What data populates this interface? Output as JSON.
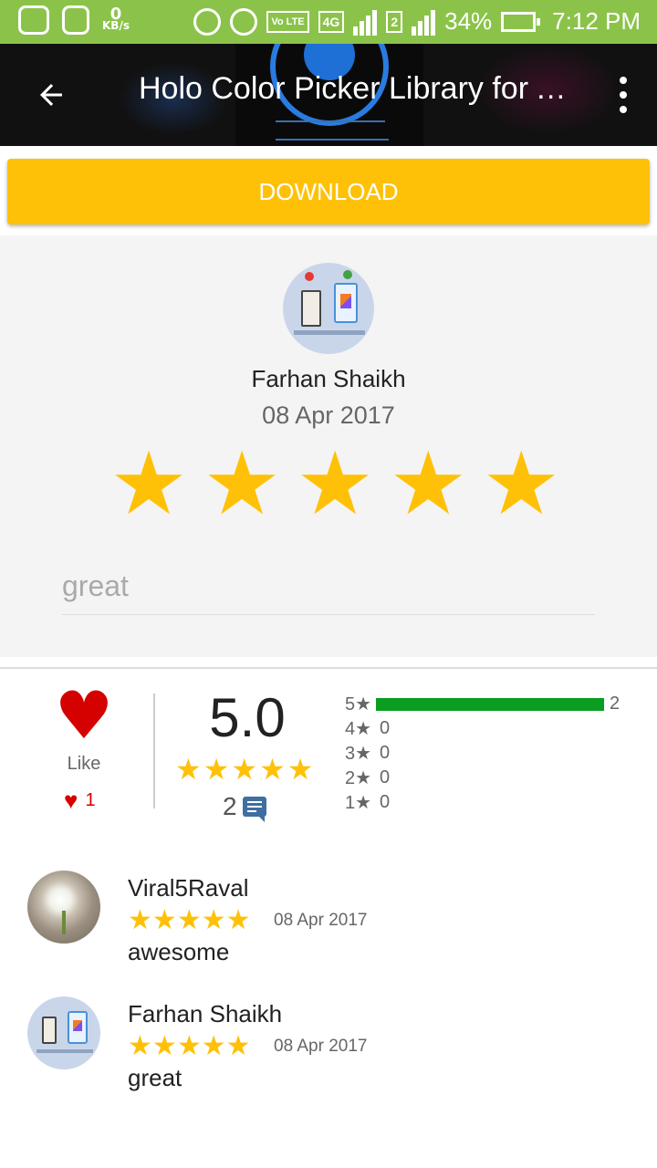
{
  "status_bar": {
    "kbs_value": "0",
    "kbs_unit": "KB/s",
    "volte_tag": "Vo LTE",
    "network_tag": "4G",
    "sim2_tag": "2",
    "battery_percent": "34%",
    "time": "7:12 PM"
  },
  "toolbar": {
    "title": "Holo Color Picker Library for Android",
    "back_icon": "arrow-back-icon",
    "menu_icon": "more-vert-icon"
  },
  "download_label": "DOWNLOAD",
  "own_review": {
    "name": "Farhan Shaikh",
    "date": "08 Apr 2017",
    "rating": 5,
    "comment_text": "great"
  },
  "like": {
    "label": "Like",
    "count": "1"
  },
  "rating_summary": {
    "score": "5.0",
    "review_count": "2",
    "distribution": [
      {
        "label": "5★",
        "count": "2",
        "fraction": 1.0
      },
      {
        "label": "4★",
        "count": "0",
        "fraction": 0
      },
      {
        "label": "3★",
        "count": "0",
        "fraction": 0
      },
      {
        "label": "2★",
        "count": "0",
        "fraction": 0
      },
      {
        "label": "1★",
        "count": "0",
        "fraction": 0
      }
    ]
  },
  "comments": [
    {
      "name": "Viral5Raval",
      "date": "08 Apr 2017",
      "text": "awesome",
      "rating": 5,
      "avatar": "flower-photo"
    },
    {
      "name": "Farhan Shaikh",
      "date": "08 Apr 2017",
      "text": "great",
      "rating": 5,
      "avatar": "robot-illustration"
    }
  ],
  "colors": {
    "status_bar": "#8bc34a",
    "accent": "#ffc107",
    "like_red": "#d50000",
    "bar_green": "#0a9d1f"
  }
}
